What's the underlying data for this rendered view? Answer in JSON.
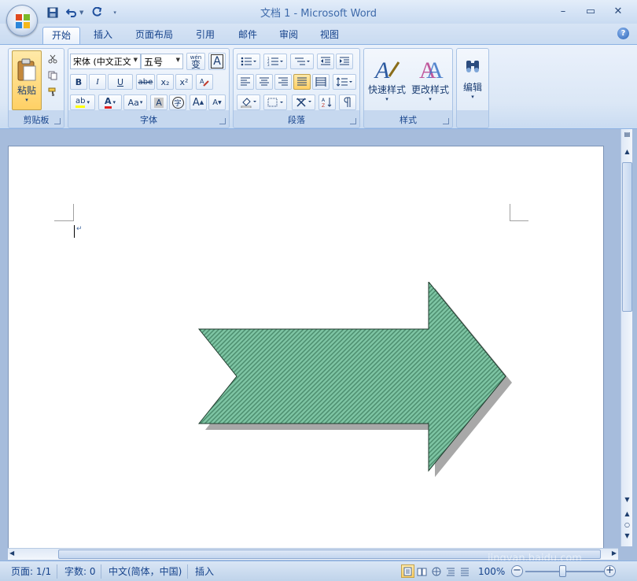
{
  "window": {
    "title": "文档 1 - Microsoft Word",
    "minimize": "–",
    "maximize": "▭",
    "close": "✕"
  },
  "tabs": [
    "开始",
    "插入",
    "页面布局",
    "引用",
    "邮件",
    "审阅",
    "视图"
  ],
  "active_tab": "开始",
  "help": "?",
  "ribbon": {
    "clipboard": {
      "label": "剪贴板",
      "paste": "粘贴"
    },
    "font": {
      "label": "字体",
      "font_name": "宋体 (中文正文)",
      "font_size": "五号",
      "wen": "wén",
      "wen_char": "变",
      "char_border": "A",
      "bold": "B",
      "italic": "I",
      "underline": "U",
      "strike": "abe",
      "subscript": "x₂",
      "superscript": "x²",
      "highlight": "ab",
      "font_color": "A",
      "change_case": "Aa",
      "char_shade": "A",
      "enclose": "字",
      "grow": "A",
      "shrink": "A"
    },
    "paragraph": {
      "label": "段落"
    },
    "styles": {
      "label": "样式",
      "quick_styles": "快速样式",
      "change_styles": "更改样式"
    },
    "editing": {
      "label": "",
      "edit": "编辑"
    }
  },
  "document": {
    "shape": "right-arrow",
    "fill_color": "#7fc6a5",
    "pattern_color": "#4e8f70",
    "outline_color": "#1e3a2c",
    "shadow_color": "#a8a8a8"
  },
  "statusbar": {
    "page": "页面: 1/1",
    "words": "字数: 0",
    "language": "中文(简体，中国)",
    "mode": "插入",
    "zoom": "100%",
    "zoom_level": 1.0
  },
  "watermark": {
    "brand": "Baidu",
    "brand_cn": "经验",
    "url": "jingyan.baidu.com"
  }
}
